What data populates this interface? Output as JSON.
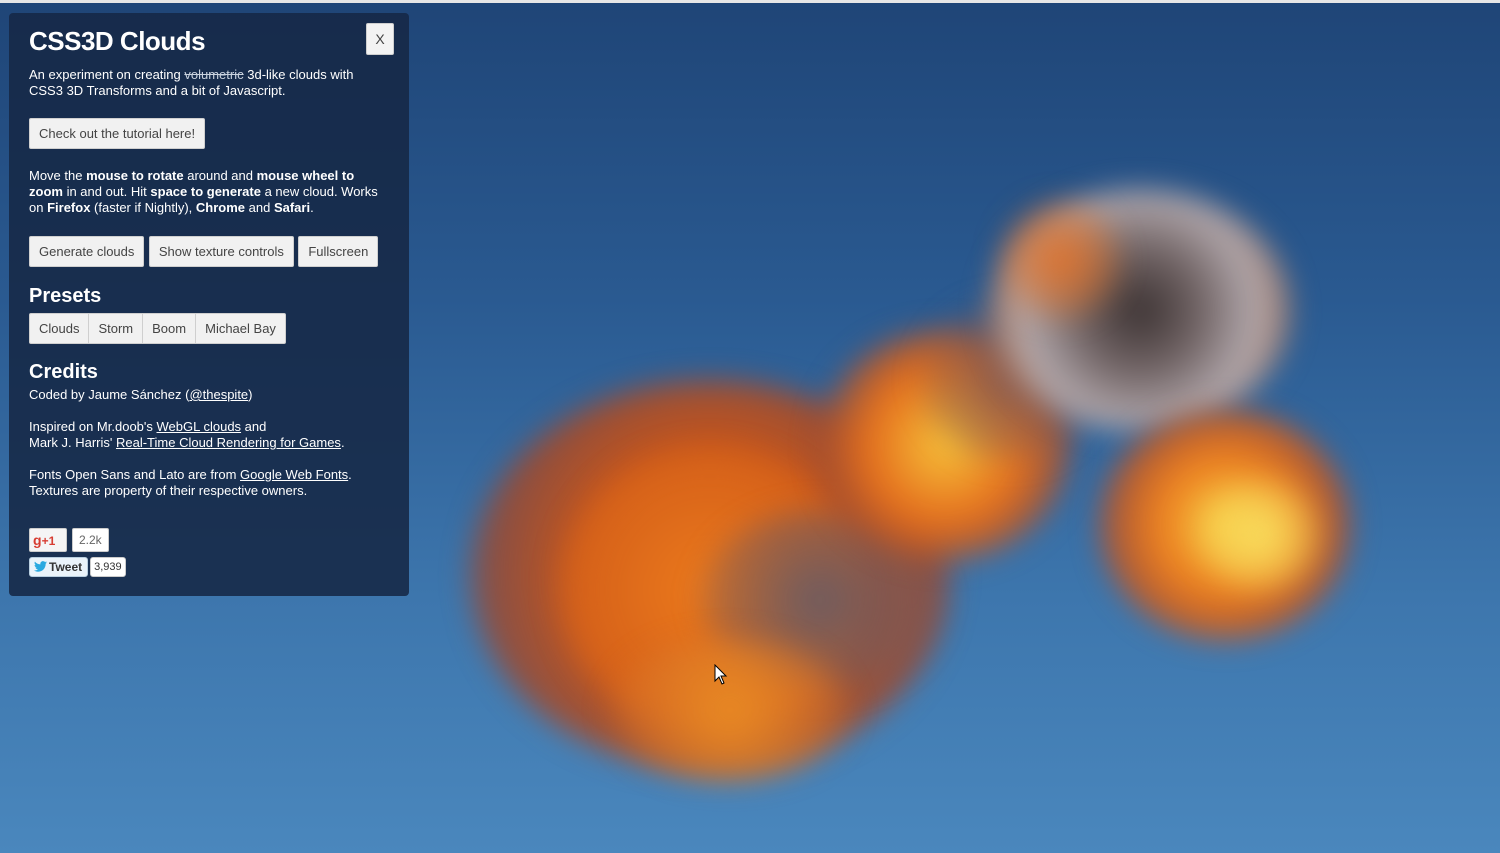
{
  "panel": {
    "title": "CSS3D Clouds",
    "close_label": "X",
    "intro_pre": "An experiment on creating ",
    "intro_strike": "volumetric",
    "intro_post": " 3d-like clouds with CSS3 3D Transforms and a bit of Javascript.",
    "tutorial_button": "Check out the tutorial here!",
    "instructions": {
      "t1": "Move the ",
      "b1": "mouse to rotate",
      "t2": " around and ",
      "b2": "mouse wheel to zoom",
      "t3": " in and out. Hit ",
      "b3": "space to generate",
      "t4": " a new cloud. Works on ",
      "b4": "Firefox",
      "t5": " (faster if Nightly), ",
      "b5": "Chrome",
      "t6": " and ",
      "b6": "Safari",
      "t7": "."
    },
    "actions": [
      "Generate clouds",
      "Show texture controls",
      "Fullscreen"
    ],
    "presets_title": "Presets",
    "presets": [
      "Clouds",
      "Storm",
      "Boom",
      "Michael Bay"
    ],
    "credits_title": "Credits",
    "credits": {
      "coded_pre": "Coded by Jaume Sánchez (",
      "coded_link": "@thespite",
      "coded_post": ")",
      "inspired_pre": "Inspired on Mr.doob's ",
      "inspired_link1": "WebGL clouds",
      "inspired_mid": " and",
      "inspired_line2_pre": "Mark J. Harris' ",
      "inspired_link2": "Real-Time Cloud Rendering for Games",
      "inspired_post": ".",
      "fonts_pre": "Fonts Open Sans and Lato are from ",
      "fonts_link": "Google Web Fonts",
      "fonts_post": ".",
      "textures": "Textures are property of their respective owners."
    },
    "social": {
      "gplus_label": "+1",
      "gplus_count": "2.2k",
      "tweet_label": "Tweet",
      "tweet_count": "3,939"
    }
  },
  "icons": [
    "close-icon",
    "google-plus-icon",
    "twitter-bird-icon",
    "mouse-cursor-icon"
  ]
}
